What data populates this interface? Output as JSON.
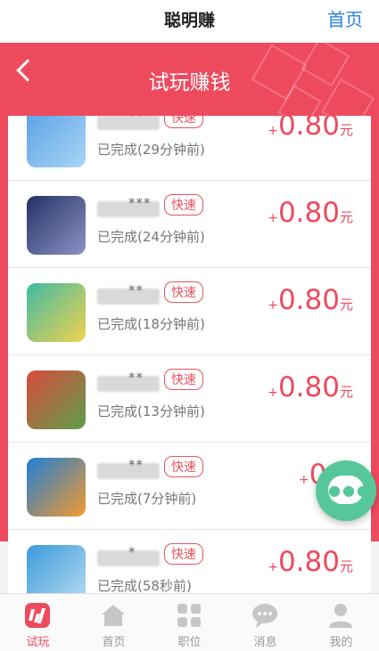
{
  "topbar": {
    "title": "聪明赚",
    "home_link": "首页"
  },
  "hero": {
    "title": "试玩赚钱"
  },
  "colors": {
    "accent": "#ee4a5e",
    "link": "#2a82e4",
    "fab": "#56c79a"
  },
  "list": [
    {
      "masked_suffix": "***",
      "tag": "快速",
      "status": "已完成(29分钟前)",
      "plus": "+",
      "amount": "0.80",
      "unit": "元",
      "icon_colors": [
        "#5aa0e6",
        "#a9d6f5"
      ]
    },
    {
      "masked_suffix": "***",
      "tag": "快速",
      "status": "已完成(24分钟前)",
      "plus": "+",
      "amount": "0.80",
      "unit": "元",
      "icon_colors": [
        "#253166",
        "#8a93c4"
      ]
    },
    {
      "masked_suffix": "**",
      "tag": "快速",
      "status": "已完成(18分钟前)",
      "plus": "+",
      "amount": "0.80",
      "unit": "元",
      "icon_colors": [
        "#3fbba4",
        "#f2d24d"
      ]
    },
    {
      "masked_suffix": "**",
      "tag": "快速",
      "status": "已完成(13分钟前)",
      "plus": "+",
      "amount": "0.80",
      "unit": "元",
      "icon_colors": [
        "#d94a3c",
        "#5d9f4b"
      ]
    },
    {
      "masked_suffix": "**",
      "tag": "快速",
      "status": "已完成(7分钟前)",
      "plus": "+",
      "amount": "0.8",
      "unit": "",
      "icon_colors": [
        "#1f7fd6",
        "#f29a2e"
      ]
    },
    {
      "masked_suffix": "*",
      "tag": "快速",
      "status": "已完成(58秒前)",
      "plus": "+",
      "amount": "0.80",
      "unit": "元",
      "icon_colors": [
        "#3a9ad9",
        "#b9dcf4"
      ]
    }
  ],
  "tabs": [
    {
      "label": "试玩",
      "icon": "task-icon",
      "active": true
    },
    {
      "label": "首页",
      "icon": "home-icon",
      "active": false
    },
    {
      "label": "职位",
      "icon": "grid-icon",
      "active": false
    },
    {
      "label": "消息",
      "icon": "chat-icon",
      "active": false
    },
    {
      "label": "我的",
      "icon": "user-icon",
      "active": false
    }
  ]
}
